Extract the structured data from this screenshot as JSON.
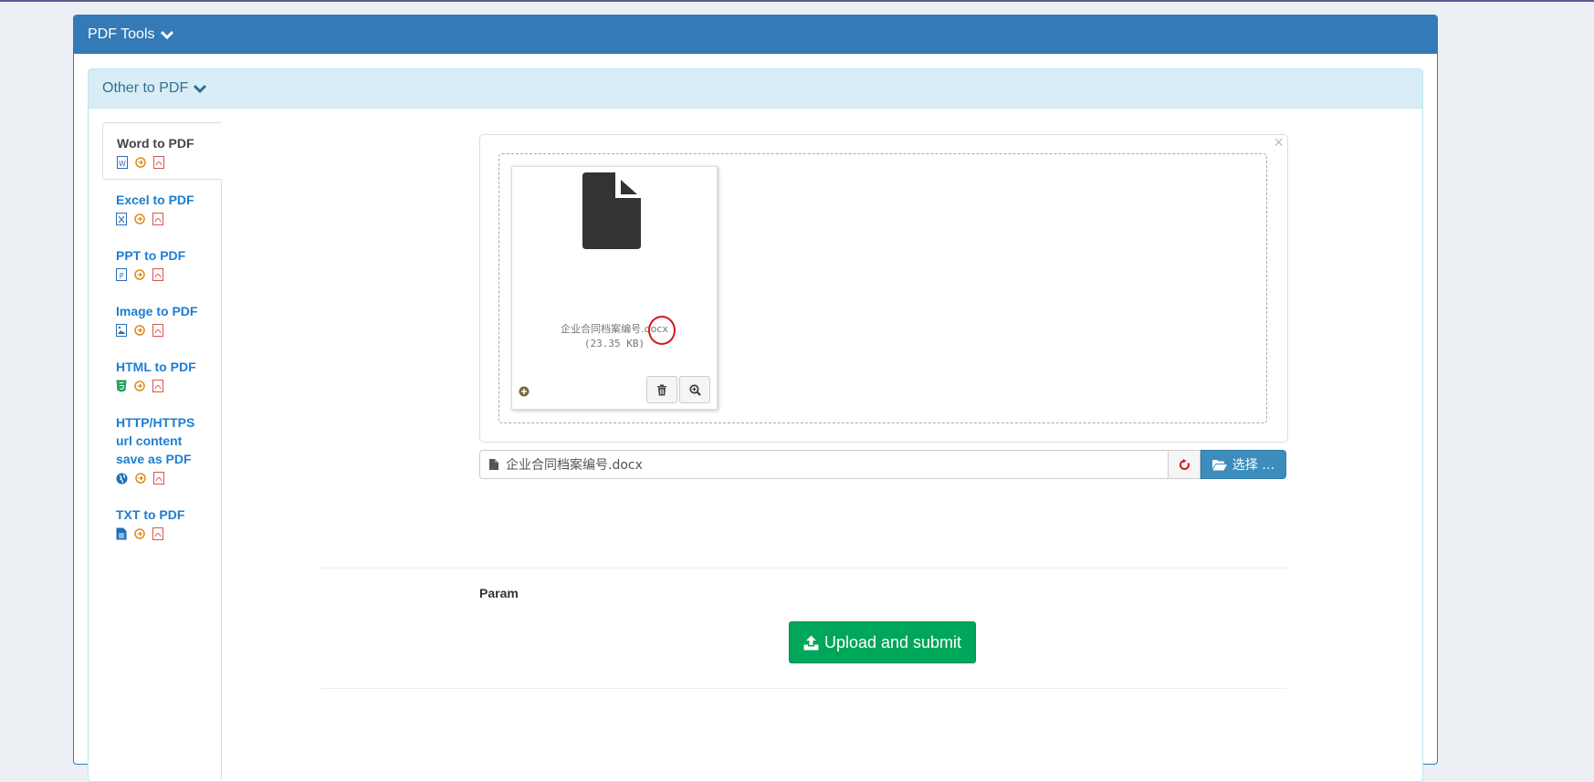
{
  "outer_panel": {
    "title": "PDF Tools"
  },
  "inner_panel": {
    "title": "Other to PDF"
  },
  "nav": {
    "items": [
      {
        "label": "Word to PDF",
        "active": true,
        "icon": "word-file-icon"
      },
      {
        "label": "Excel to PDF",
        "active": false,
        "icon": "excel-file-icon"
      },
      {
        "label": "PPT to PDF",
        "active": false,
        "icon": "ppt-file-icon"
      },
      {
        "label": "Image to PDF",
        "active": false,
        "icon": "image-file-icon"
      },
      {
        "label": "HTML to PDF",
        "active": false,
        "icon": "html5-icon"
      },
      {
        "label": "HTTP/HTTPS url content save as PDF",
        "active": false,
        "icon": "globe-icon"
      },
      {
        "label": "TXT to PDF",
        "active": false,
        "icon": "text-file-icon"
      }
    ]
  },
  "upload": {
    "preview": {
      "close_symbol": "×",
      "file_name_base": "企业合同档案编号",
      "file_ext": ".docx",
      "file_size": "(23.35 KB)"
    },
    "caption_text": "企业合同档案编号.docx",
    "browse_label": "选择 …"
  },
  "param": {
    "label": "Param"
  },
  "submit": {
    "label": "Upload and submit"
  },
  "colors": {
    "primary": "#337ab7",
    "info_bg": "#d9edf7",
    "success": "#00a65a",
    "link": "#1d7dd1"
  }
}
